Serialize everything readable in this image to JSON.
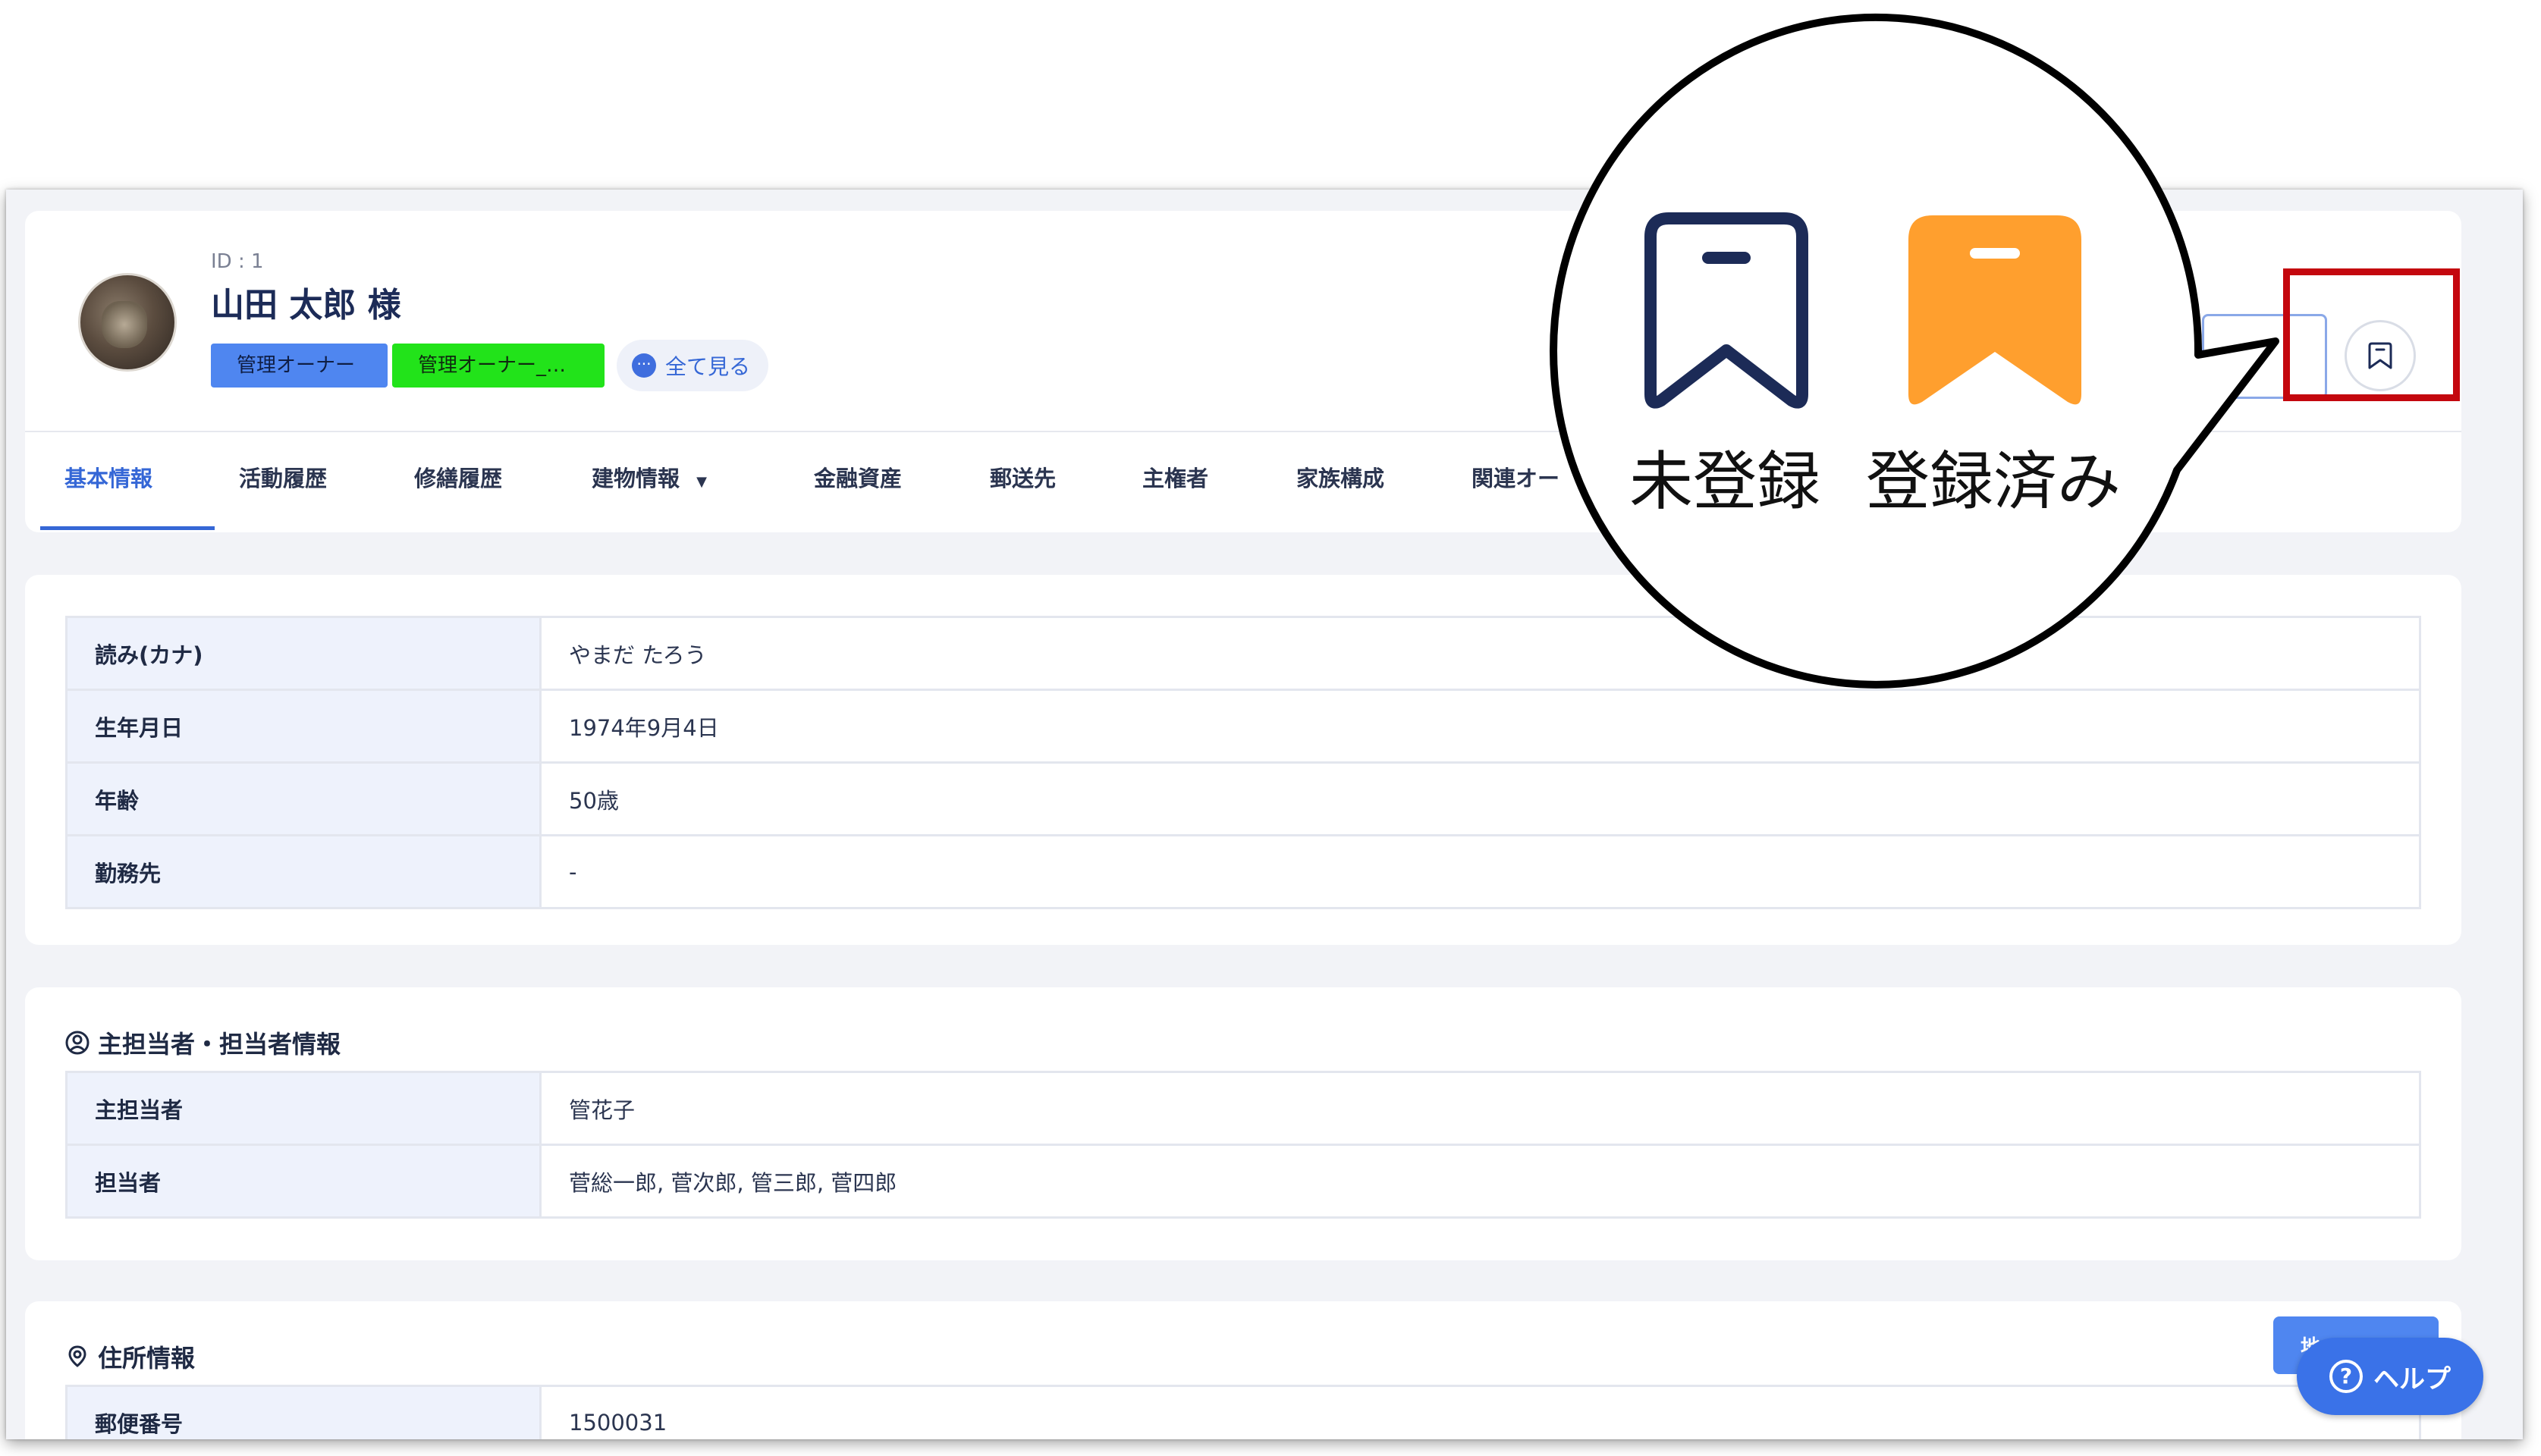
{
  "header": {
    "user_id": "ID : 1",
    "user_name": "山田 太郎 様",
    "tags": [
      "管理オーナー",
      "管理オーナー_…"
    ],
    "see_all": "全て見る"
  },
  "tabs": [
    "基本情報",
    "活動履歴",
    "修繕履歴",
    "建物情報",
    "金融資産",
    "郵送先",
    "主権者",
    "家族構成",
    "関連オー"
  ],
  "active_tab": "基本情報",
  "basic_info": [
    {
      "key": "読み(カナ)",
      "value": "やまだ たろう"
    },
    {
      "key": "生年月日",
      "value": "1974年9月4日"
    },
    {
      "key": "年齢",
      "value": "50歳"
    },
    {
      "key": "勤務先",
      "value": "-"
    }
  ],
  "staff_section": {
    "title": "主担当者・担当者情報",
    "rows": [
      {
        "key": "主担当者",
        "value": "管花子"
      },
      {
        "key": "担当者",
        "value": "菅総一郎, 菅次郎, 管三郎, 菅四郎"
      }
    ]
  },
  "address_section": {
    "title": "住所情報",
    "map_button": "地",
    "rows": [
      {
        "key": "郵便番号",
        "value": "1500031"
      }
    ]
  },
  "help_button": "ヘルプ",
  "callout": {
    "unregistered_label": "未登録",
    "registered_label": "登録済み",
    "unregistered_color": "#1c2b57",
    "registered_color": "#ff9f2e"
  },
  "highlight_color": "#c4070e"
}
